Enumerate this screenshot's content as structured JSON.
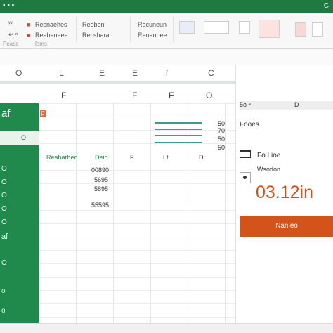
{
  "titlebar": {
    "quick_access": "▪ ▪ ▪",
    "right_text": "C"
  },
  "ribbon": {
    "left_rows": [
      "ᵛ͏ᵛ",
      "↩ ⁿ"
    ],
    "group1": [
      "Resnaehes",
      "Reabaneee"
    ],
    "group2": [
      "Reoben",
      "Recsharan"
    ],
    "group3": [
      "Recuneun",
      "Reoanbee"
    ],
    "labels": [
      "Pease",
      "ſoms"
    ]
  },
  "columns": [
    "O",
    "L",
    "E",
    "E",
    "ſ",
    "C"
  ],
  "row2": [
    "F",
    "F",
    "E",
    "O"
  ],
  "sidebar": {
    "title": "af",
    "item": "O",
    "letters": [
      "O",
      "O",
      "O",
      "O",
      "O",
      "O",
      "o",
      "o",
      "af"
    ]
  },
  "grid": {
    "cornermark": "F",
    "header_cells": [
      "Reabarhed",
      "Deid",
      "F",
      "Lt",
      "D"
    ],
    "values": [
      "00890",
      "5695",
      "5895",
      "55595"
    ],
    "right_values": [
      "50",
      "70",
      "50",
      "50"
    ]
  },
  "panel": {
    "top_left": "5o ᵃ",
    "top_right": "D",
    "line1": "Fooes",
    "item_label": "Fo Lioe",
    "item_sub": "Wsodon",
    "big_value": "03.12in",
    "cta_label": "Nanieo"
  },
  "colors": {
    "brand_green": "#1f8a4c",
    "accent_orange": "#d4531b"
  }
}
